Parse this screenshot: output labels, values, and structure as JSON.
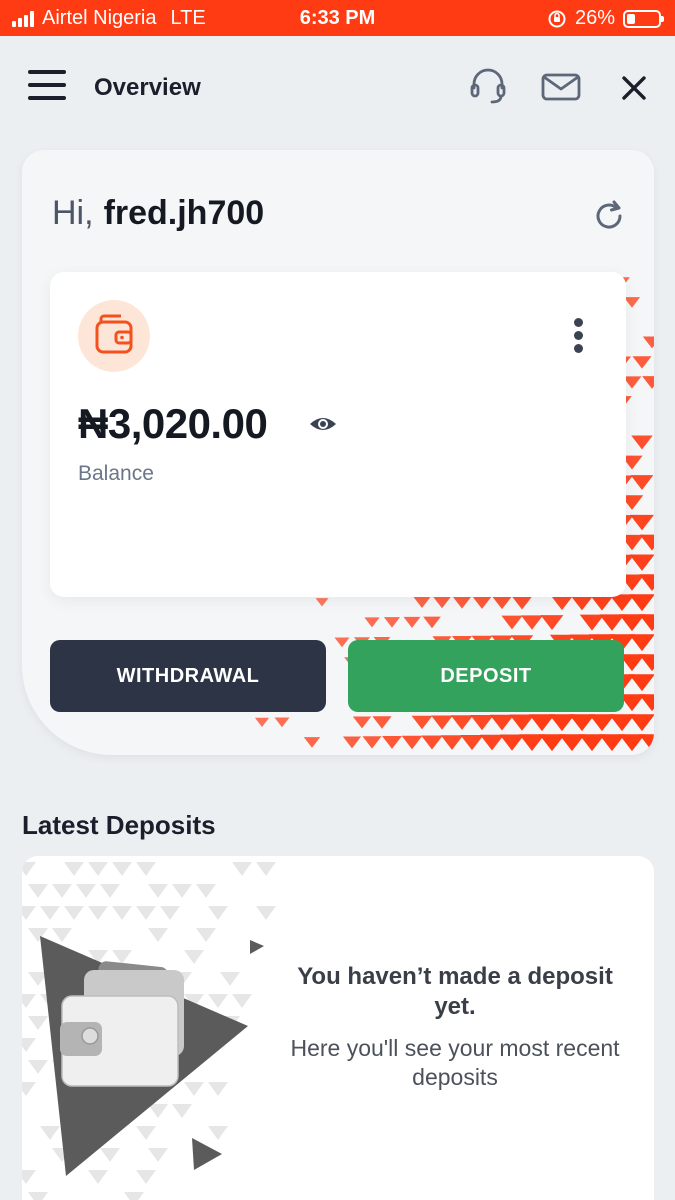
{
  "status_bar": {
    "carrier": "Airtel Nigeria",
    "network": "LTE",
    "time": "6:33 PM",
    "battery": "26%",
    "battery_level": 0.26
  },
  "header": {
    "title": "Overview",
    "icons": [
      "menu-icon",
      "headset-icon",
      "mail-icon",
      "close-icon"
    ]
  },
  "greeting": {
    "hi": "Hi,",
    "username": "fred.jh700"
  },
  "wallet": {
    "balance": "₦3,020.00",
    "balance_label": "Balance"
  },
  "actions": {
    "withdrawal": "WITHDRAWAL",
    "deposit": "DEPOSIT"
  },
  "latest_deposits": {
    "title": "Latest Deposits",
    "empty_title": "You haven’t made a deposit yet.",
    "empty_subtitle": "Here you'll see your most recent deposits"
  },
  "colors": {
    "accent": "#ff3b14",
    "dark_button": "#2c3445",
    "deposit_button": "#33a25c",
    "wallet_icon": "#f4511e",
    "wallet_bg": "#fde6d8"
  }
}
